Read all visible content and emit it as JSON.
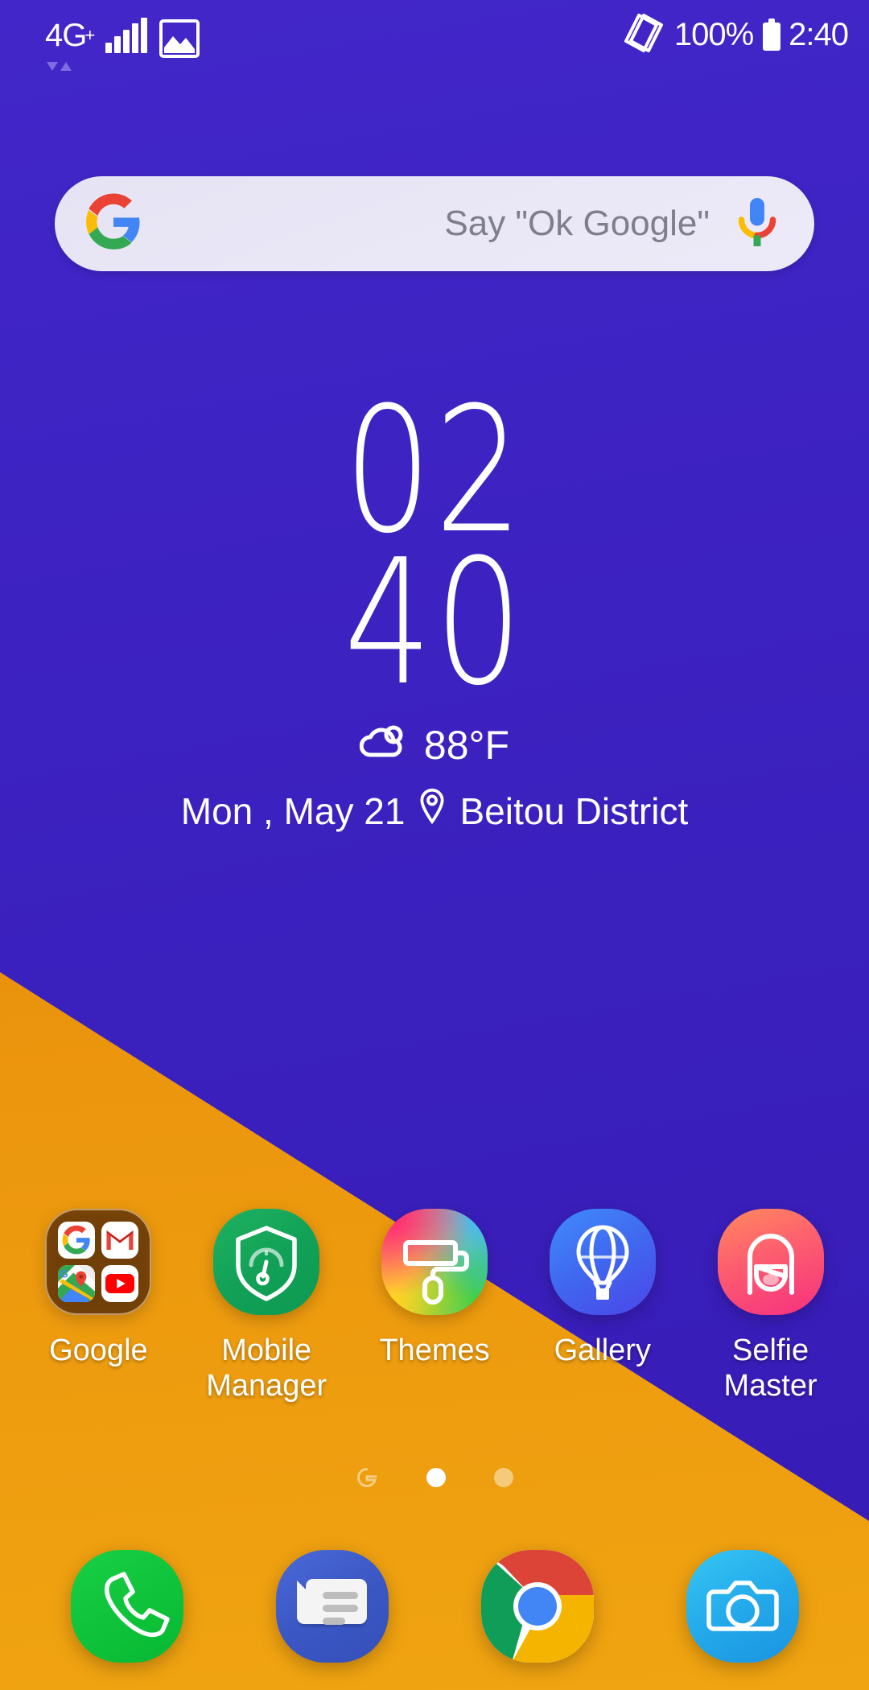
{
  "status_bar": {
    "network_type": "4G",
    "network_plus": "+",
    "data_arrows_icon": "data-transfer-arrows-icon",
    "signal_icon": "signal-bars-icon",
    "screenshot_icon": "screenshot-image-icon",
    "rotate_icon": "auto-rotate-icon",
    "battery_percent": "100%",
    "battery_icon": "battery-full-icon",
    "clock": "2:40"
  },
  "search": {
    "google_logo_icon": "google-g-icon",
    "placeholder": "Say \"Ok Google\"",
    "mic_icon": "google-mic-icon",
    "value": ""
  },
  "clock_widget": {
    "hours": "02",
    "minutes": "40",
    "weather_icon": "partly-cloudy-icon",
    "temperature": "88°F",
    "date": "Mon , May 21",
    "location_icon": "location-pin-icon",
    "location": "Beitou District"
  },
  "apps": [
    {
      "label": "Google",
      "icon": "google-folder-icon",
      "type": "folder",
      "folder_items": [
        "google-g-icon",
        "gmail-icon",
        "google-maps-icon",
        "youtube-icon"
      ]
    },
    {
      "label": "Mobile\nManager",
      "icon": "shield-gauge-icon",
      "type": "app"
    },
    {
      "label": "Themes",
      "icon": "paint-roller-icon",
      "type": "app"
    },
    {
      "label": "Gallery",
      "icon": "hot-air-balloon-icon",
      "type": "app"
    },
    {
      "label": "Selfie\nMaster",
      "icon": "selfie-face-icon",
      "type": "app"
    }
  ],
  "app_labels": {
    "google": "Google",
    "mobile_manager_line1": "Mobile",
    "mobile_manager_line2": "Manager",
    "themes": "Themes",
    "gallery": "Gallery",
    "selfie_line1": "Selfie",
    "selfie_line2": "Master"
  },
  "page_indicator": {
    "google_page_icon": "google-feed-page-icon",
    "pages": 2,
    "current_page": 1
  },
  "dock": [
    {
      "label": "Phone",
      "icon": "phone-handset-icon"
    },
    {
      "label": "Messages",
      "icon": "message-bubble-icon"
    },
    {
      "label": "Chrome",
      "icon": "chrome-icon"
    },
    {
      "label": "Camera",
      "icon": "camera-icon"
    }
  ],
  "colors": {
    "wallpaper_purple": "#3a20be",
    "wallpaper_orange": "#e0820b",
    "search_bar_bg": "#e9e7f6",
    "accent_white": "#ffffff",
    "phone_green": "#10c23b",
    "messages_blue": "#3b5ac3",
    "camera_blue": "#22a8ea",
    "mobile_manager_green": "#12a35a",
    "selfie_pink": "#f4496f"
  }
}
